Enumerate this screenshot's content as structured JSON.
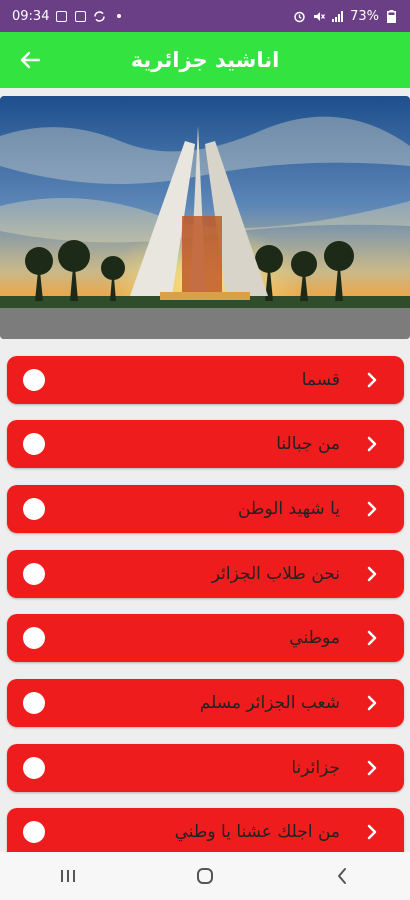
{
  "status_bar": {
    "time": "09:34",
    "battery": "73%",
    "icons_left": [
      "image-icon",
      "mail-icon",
      "sync-icon",
      "dot-icon"
    ],
    "icons_right": [
      "alarm-icon",
      "mute-icon",
      "signal-icon",
      "battery-icon"
    ]
  },
  "app_bar": {
    "title": "اناشيد جزائرية",
    "back_icon": "arrow-left-icon",
    "background": "#33e340"
  },
  "hero": {
    "description_icon": "martyrs-memorial-photo"
  },
  "songs": [
    {
      "title": "قسما"
    },
    {
      "title": "من جبالنا"
    },
    {
      "title": "يا شهيد الوطن"
    },
    {
      "title": "نحن طلاب الجزائر"
    },
    {
      "title": "موطني"
    },
    {
      "title": "شعب الجزائر مسلم"
    },
    {
      "title": "جزائرنا"
    },
    {
      "title": "من اجلك عشنا يا وطني"
    }
  ],
  "colors": {
    "accent": "#ee1c1c",
    "status_bar": "#6b3f86"
  },
  "nav_bar": {
    "buttons": [
      "recents-icon",
      "home-icon",
      "back-icon"
    ]
  }
}
